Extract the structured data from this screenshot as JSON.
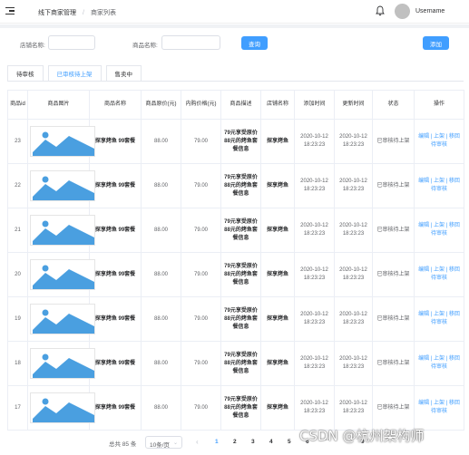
{
  "header": {
    "breadcrumb": [
      "线下商家管理",
      "商家列表"
    ],
    "username": "Username"
  },
  "filters": {
    "shop_name_label": "店铺名称:",
    "shop_name_value": "",
    "product_name_label": "商品名称:",
    "product_name_value": "",
    "search_label": "查询",
    "add_label": "添加"
  },
  "tabs": [
    {
      "label": "待审核",
      "active": false
    },
    {
      "label": "已审核待上架",
      "active": true
    },
    {
      "label": "售卖中",
      "active": false
    }
  ],
  "table": {
    "columns": [
      "商品id",
      "商品图片",
      "商品名称",
      "商品原价(元)",
      "内购价格(元)",
      "商品描述",
      "店铺名称",
      "添加时间",
      "更新时间",
      "状态",
      "操作"
    ],
    "rows": [
      {
        "id": "23",
        "name": "探享烤鱼 99套餐",
        "orig": "88.00",
        "price": "79.00",
        "desc": "79元享受原价88元的烤鱼套餐信息",
        "shop": "探享烤鱼",
        "added": "2020-10-12 18:23:23",
        "updated": "2020-10-12 18:23:23",
        "status": "已审核待上架",
        "ops": "编辑 | 上架 | 移回待审核"
      },
      {
        "id": "22",
        "name": "探享烤鱼 99套餐",
        "orig": "88.00",
        "price": "79.00",
        "desc": "79元享受原价88元的烤鱼套餐信息",
        "shop": "探享烤鱼",
        "added": "2020-10-12 18:23:23",
        "updated": "2020-10-12 18:23:23",
        "status": "已审核待上架",
        "ops": "编辑 | 上架 | 移回待审核"
      },
      {
        "id": "21",
        "name": "探享烤鱼 99套餐",
        "orig": "88.00",
        "price": "79.00",
        "desc": "79元享受原价88元的烤鱼套餐信息",
        "shop": "探享烤鱼",
        "added": "2020-10-12 18:23:23",
        "updated": "2020-10-12 18:23:23",
        "status": "已审核待上架",
        "ops": "编辑 | 上架 | 移回待审核"
      },
      {
        "id": "20",
        "name": "探享烤鱼 99套餐",
        "orig": "88.00",
        "price": "79.00",
        "desc": "79元享受原价88元的烤鱼套餐信息",
        "shop": "探享烤鱼",
        "added": "2020-10-12 18:23:23",
        "updated": "2020-10-12 18:23:23",
        "status": "已审核待上架",
        "ops": "编辑 | 上架 | 移回待审核"
      },
      {
        "id": "19",
        "name": "探享烤鱼 99套餐",
        "orig": "88.00",
        "price": "79.00",
        "desc": "79元享受原价88元的烤鱼套餐信息",
        "shop": "探享烤鱼",
        "added": "2020-10-12 18:23:23",
        "updated": "2020-10-12 18:23:23",
        "status": "已审核待上架",
        "ops": "编辑 | 上架 | 移回待审核"
      },
      {
        "id": "18",
        "name": "探享烤鱼 99套餐",
        "orig": "88.00",
        "price": "79.00",
        "desc": "79元享受原价88元的烤鱼套餐信息",
        "shop": "探享烤鱼",
        "added": "2020-10-12 18:23:23",
        "updated": "2020-10-12 18:23:23",
        "status": "已审核待上架",
        "ops": "编辑 | 上架 | 移回待审核"
      },
      {
        "id": "17",
        "name": "探享烤鱼 99套餐",
        "orig": "88.00",
        "price": "79.00",
        "desc": "79元享受原价88元的烤鱼套餐信息",
        "shop": "探享烤鱼",
        "added": "2020-10-12 18:23:23",
        "updated": "2020-10-12 18:23:23",
        "status": "已审核待上架",
        "ops": "编辑 | 上架 | 移回待审核"
      }
    ]
  },
  "pagination": {
    "total": "总共 85 条",
    "page_size": "10条/页",
    "pages": [
      "1",
      "2",
      "3",
      "4",
      "5",
      "6"
    ],
    "current": "1",
    "ellipsis": "···",
    "last": "9"
  },
  "watermark": "CSDN @杭州架构师",
  "colors": {
    "accent": "#409eff",
    "image_blue": "#4a9fe0"
  },
  "icons": {
    "menu": "menu-fold-icon",
    "bell": "bell-icon",
    "image": "image-placeholder-icon",
    "prev": "chevron-left-icon",
    "dropdown": "chevron-down-icon"
  }
}
